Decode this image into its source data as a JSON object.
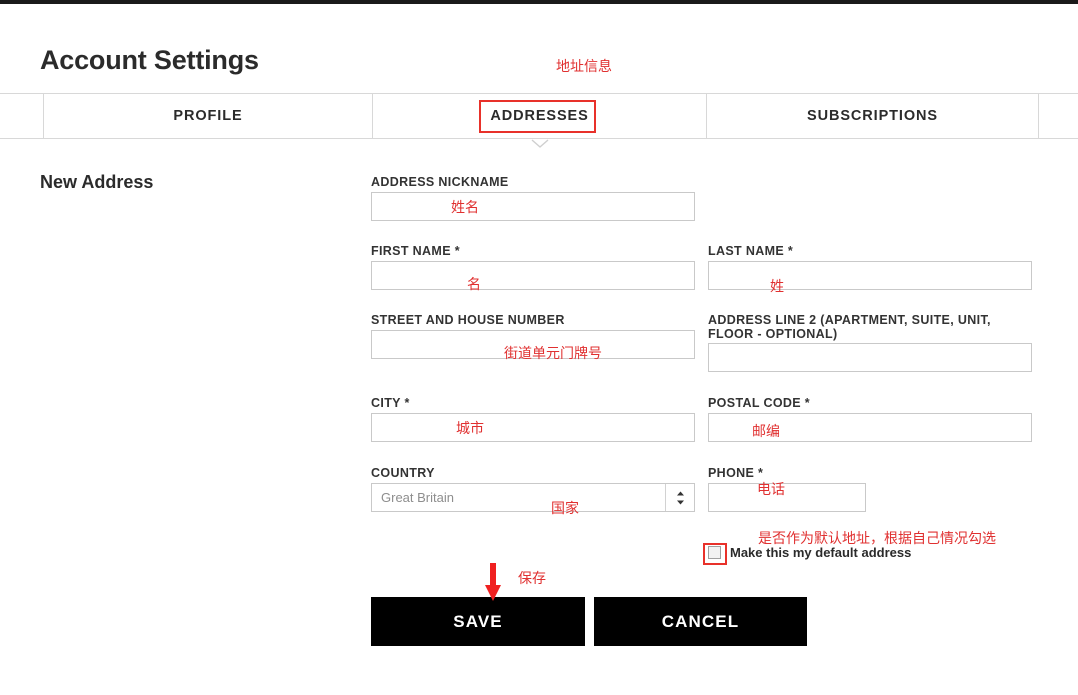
{
  "page": {
    "title": "Account Settings",
    "section_title": "New Address"
  },
  "tabs": [
    {
      "label": "PROFILE",
      "active": false
    },
    {
      "label": "ADDRESSES",
      "active": true
    },
    {
      "label": "SUBSCRIPTIONS",
      "active": false
    }
  ],
  "form": {
    "address_nickname": {
      "label": "ADDRESS NICKNAME",
      "value": "",
      "placeholder": ""
    },
    "first_name": {
      "label": "FIRST NAME *",
      "value": "",
      "placeholder": ""
    },
    "last_name": {
      "label": "LAST NAME *",
      "value": "",
      "placeholder": ""
    },
    "street": {
      "label": "STREET AND HOUSE NUMBER",
      "value": "",
      "placeholder": ""
    },
    "address_line_2": {
      "label": "ADDRESS LINE 2 (APARTMENT, SUITE, UNIT, FLOOR - OPTIONAL)",
      "value": "",
      "placeholder": ""
    },
    "city": {
      "label": "CITY *",
      "value": "",
      "placeholder": ""
    },
    "postal_code": {
      "label": "POSTAL CODE *",
      "value": "",
      "placeholder": ""
    },
    "country": {
      "label": "COUNTRY",
      "selected": "Great Britain"
    },
    "phone": {
      "label": "PHONE *",
      "value": "",
      "placeholder": ""
    },
    "default_address": {
      "label": "Make this my default address",
      "checked": false
    }
  },
  "actions": {
    "save": "SAVE",
    "cancel": "CANCEL"
  },
  "annotations": {
    "header": "地址信息",
    "nickname": "姓名",
    "first_name": "名",
    "last_name": "姓",
    "street": "街道单元门牌号",
    "city": "城市",
    "postal_code": "邮编",
    "country": "国家",
    "phone": "电话",
    "default_address": "是否作为默认地址，根据自己情况勾选",
    "save": "保存"
  },
  "colors": {
    "annotation_red": "#e03030",
    "highlight_red": "#e8312a",
    "button_black": "#000000",
    "border_gray": "#c9c9c9"
  }
}
